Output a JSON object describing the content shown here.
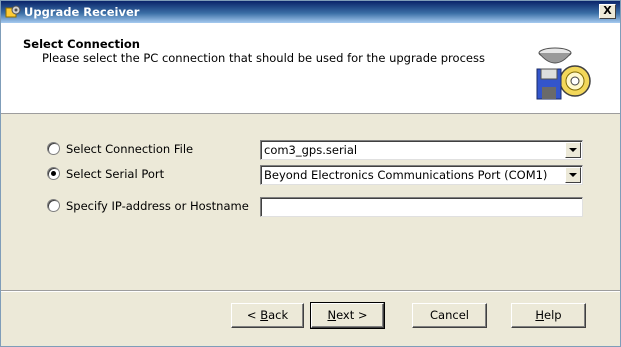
{
  "window": {
    "title": "Upgrade Receiver",
    "icon": "app-gear-icon",
    "close_label": "X"
  },
  "header": {
    "title": "Select Connection",
    "description": "Please select the PC connection that should be used for the upgrade process",
    "art_icon": "floppy-disk-cd-icon"
  },
  "options": [
    {
      "label": "Select Connection File",
      "checked": false,
      "value": "com3_gps.serial",
      "kind": "dropdown"
    },
    {
      "label": "Select Serial Port",
      "checked": true,
      "value": "Beyond Electronics Communications Port (COM1)",
      "kind": "dropdown"
    },
    {
      "label": "Specify IP-address or Hostname",
      "checked": false,
      "value": "",
      "kind": "text"
    }
  ],
  "buttons": {
    "back": {
      "prefix": "< ",
      "mnemonic": "B",
      "rest": "ack"
    },
    "next": {
      "prefix": "",
      "mnemonic": "N",
      "rest": "ext >"
    },
    "cancel": "Cancel",
    "help": {
      "prefix": "",
      "mnemonic": "H",
      "rest": "elp"
    }
  },
  "colors": {
    "titlebar_start": "#0a246a",
    "titlebar_end": "#a6caf0",
    "dialog_face": "#ece9d8"
  }
}
